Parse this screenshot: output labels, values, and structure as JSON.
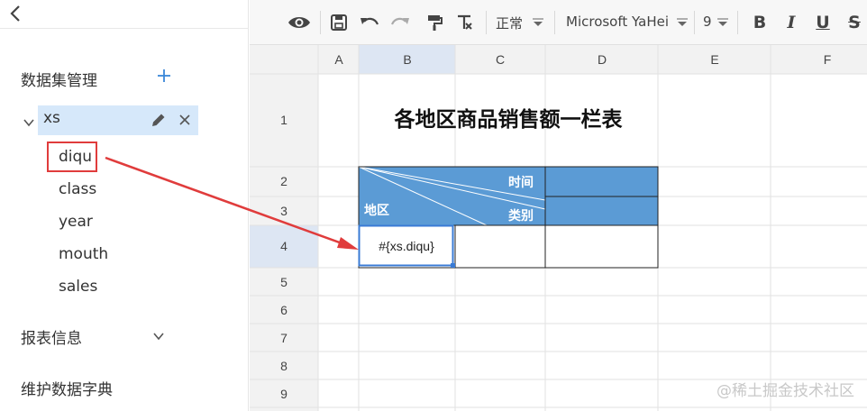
{
  "sidebar": {
    "dataset_section_title": "数据集管理",
    "dataset": {
      "name": "xs",
      "fields": [
        "diqu",
        "class",
        "year",
        "mouth",
        "sales"
      ]
    },
    "report_info_title": "报表信息",
    "dict_title": "维护数据字典"
  },
  "toolbar": {
    "style_label": "正常",
    "font_label": "Microsoft YaHei",
    "size_label": "9",
    "icons": [
      "eye-icon",
      "save-icon",
      "undo-icon",
      "redo-icon",
      "format-painter-icon",
      "clear-format-icon",
      "bold-icon",
      "italic-icon",
      "underline-icon",
      "strikethrough-icon"
    ]
  },
  "sheet": {
    "columns": [
      "A",
      "B",
      "C",
      "D",
      "E",
      "F"
    ],
    "rows": [
      "1",
      "2",
      "3",
      "4",
      "5",
      "6",
      "7",
      "8",
      "9"
    ],
    "title": "各地区商品销售额一栏表",
    "header_time": "时间",
    "header_category": "类别",
    "header_region": "地区",
    "selected_cell_value": "#{xs.diqu}",
    "header_color": "#5b9bd5"
  },
  "watermark": "@稀土掘金技术社区"
}
